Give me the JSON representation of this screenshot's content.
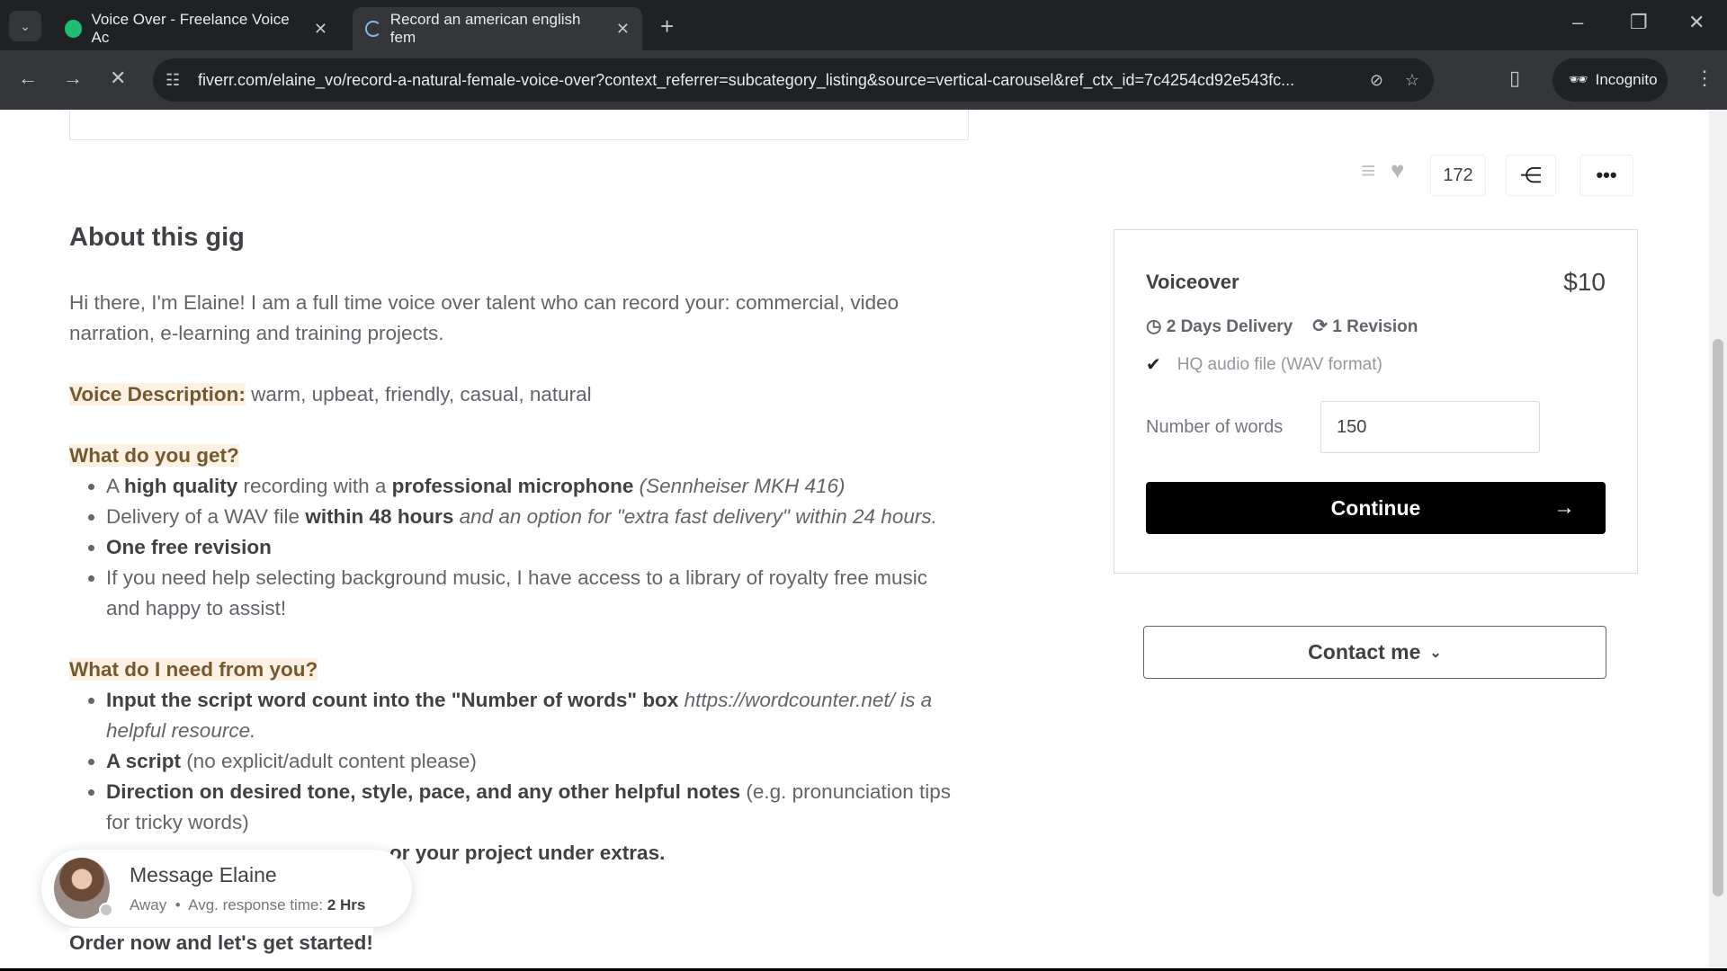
{
  "browser": {
    "tabs": [
      {
        "title": "Voice Over - Freelance Voice Ac",
        "icon": "fiverr-icon"
      },
      {
        "title": "Record an american english fem",
        "icon": "loading-icon"
      }
    ],
    "url": "fiverr.com/elaine_vo/record-a-natural-female-voice-over?context_referrer=subcategory_listing&source=vertical-carousel&ref_ctx_id=7c4254cd92e543fc...",
    "incognito_label": "Incognito"
  },
  "gig": {
    "heading": "About this gig",
    "intro": "Hi there, I'm Elaine! I am a full time voice over talent who can record your: commercial, video narration, e-learning and training projects.",
    "voice_label": "Voice Description:",
    "voice_text": " warm, upbeat, friendly, casual, natural",
    "get_heading": "What do you get?",
    "get_items": [
      [
        "A ",
        "high quality",
        " recording with a ",
        "professional microphone",
        " (Sennheiser MKH 416)"
      ],
      [
        "Delivery of a WAV file ",
        "within 48 hours",
        " and an option for \"extra fast delivery\" within 24 hours."
      ],
      [
        "One free revision"
      ],
      [
        "If you need help selecting background music, I have access to a library of royalty free music and happy to assist!"
      ]
    ],
    "need_heading": "What do I need from you?",
    "need_items": [
      [
        "Input the script word count into the \"Number of words\" box",
        " https://wordcounter.net/ is a helpful resource."
      ],
      [
        "A script",
        " (no explicit/adult content please)"
      ],
      [
        "Direction on desired tone, style, pace, and any other helpful notes",
        " (e.g. pronunciation tips for tricky words)"
      ]
    ],
    "extras_fragment": "or your project under extras.",
    "closing": "Order now and let's get started!"
  },
  "actions": {
    "likes": "172"
  },
  "package": {
    "name": "Voiceover",
    "price": "$10",
    "delivery": "2 Days Delivery",
    "revisions": "1 Revision",
    "feature": "HQ audio file (WAV format)",
    "words_label": "Number of words",
    "words_value": "150",
    "continue_label": "Continue",
    "contact_label": "Contact me"
  },
  "message": {
    "title": "Message Elaine",
    "status": "Away",
    "response_label": "Avg. response time:",
    "response_value": "2 Hrs"
  }
}
